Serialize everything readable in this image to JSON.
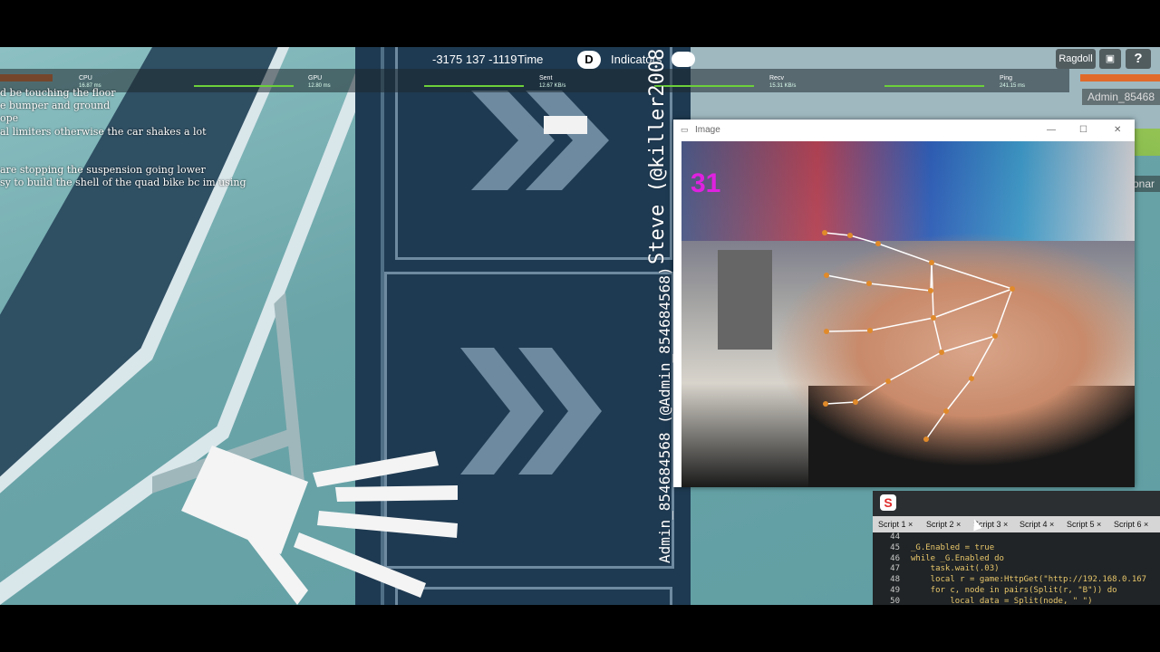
{
  "hud": {
    "coords": "-3175 137 -1119",
    "time_label": "Time",
    "indicators_key": "D",
    "indicators_label": "Indicators"
  },
  "stats": [
    {
      "label": "CPU",
      "value": "16.87 ms"
    },
    {
      "label": "GPU",
      "value": "12.80 ms"
    },
    {
      "label": "Sent",
      "value": "12.67 KB/s"
    },
    {
      "label": "Recv",
      "value": "15.31 KB/s"
    },
    {
      "label": "Ping",
      "value": "241.15 ms"
    }
  ],
  "chat": [
    "d be touching the floor",
    "e bumper and ground",
    "ope",
    "al limiters otherwise the car shakes a lot",
    "",
    "",
    "are stopping the suspension going lower",
    "sy to build the shell of the quad bike bc im using"
  ],
  "nametags": {
    "steve_display": "Steve (@killer2008",
    "admin_display": "Admin_854684568 (@Admin_854684568)"
  },
  "topright": {
    "ragdoll_label": "Ragdoll",
    "help_label": "?",
    "admin_tag": "Admin_85468",
    "side_tag": "onar"
  },
  "image_window": {
    "title": "Image",
    "min_label": "—",
    "max_label": "☐",
    "close_label": "✕",
    "counter": "31"
  },
  "editor": {
    "logo": "S",
    "tabs": [
      "Script 1",
      "Script 2",
      "Script 3",
      "Script 4",
      "Script 5",
      "Script 6"
    ],
    "lines": [
      {
        "n": "44",
        "t": ""
      },
      {
        "n": "45",
        "t": "_G.Enabled = true"
      },
      {
        "n": "46",
        "t": "while _G.Enabled do"
      },
      {
        "n": "47",
        "t": "    task.wait(.03)"
      },
      {
        "n": "48",
        "t": "    local r = game:HttpGet(\"http://192.168.0.167"
      },
      {
        "n": "49",
        "t": "    for c, node in pairs(Split(r, \"B\")) do"
      },
      {
        "n": "50",
        "t": "        local data = Split(node, \" \")"
      }
    ]
  },
  "colors": {
    "counter": "#e021e0",
    "stat_line": "#6cd03a",
    "orange_bar": "#e06a2a",
    "road": "#1e3a52"
  }
}
